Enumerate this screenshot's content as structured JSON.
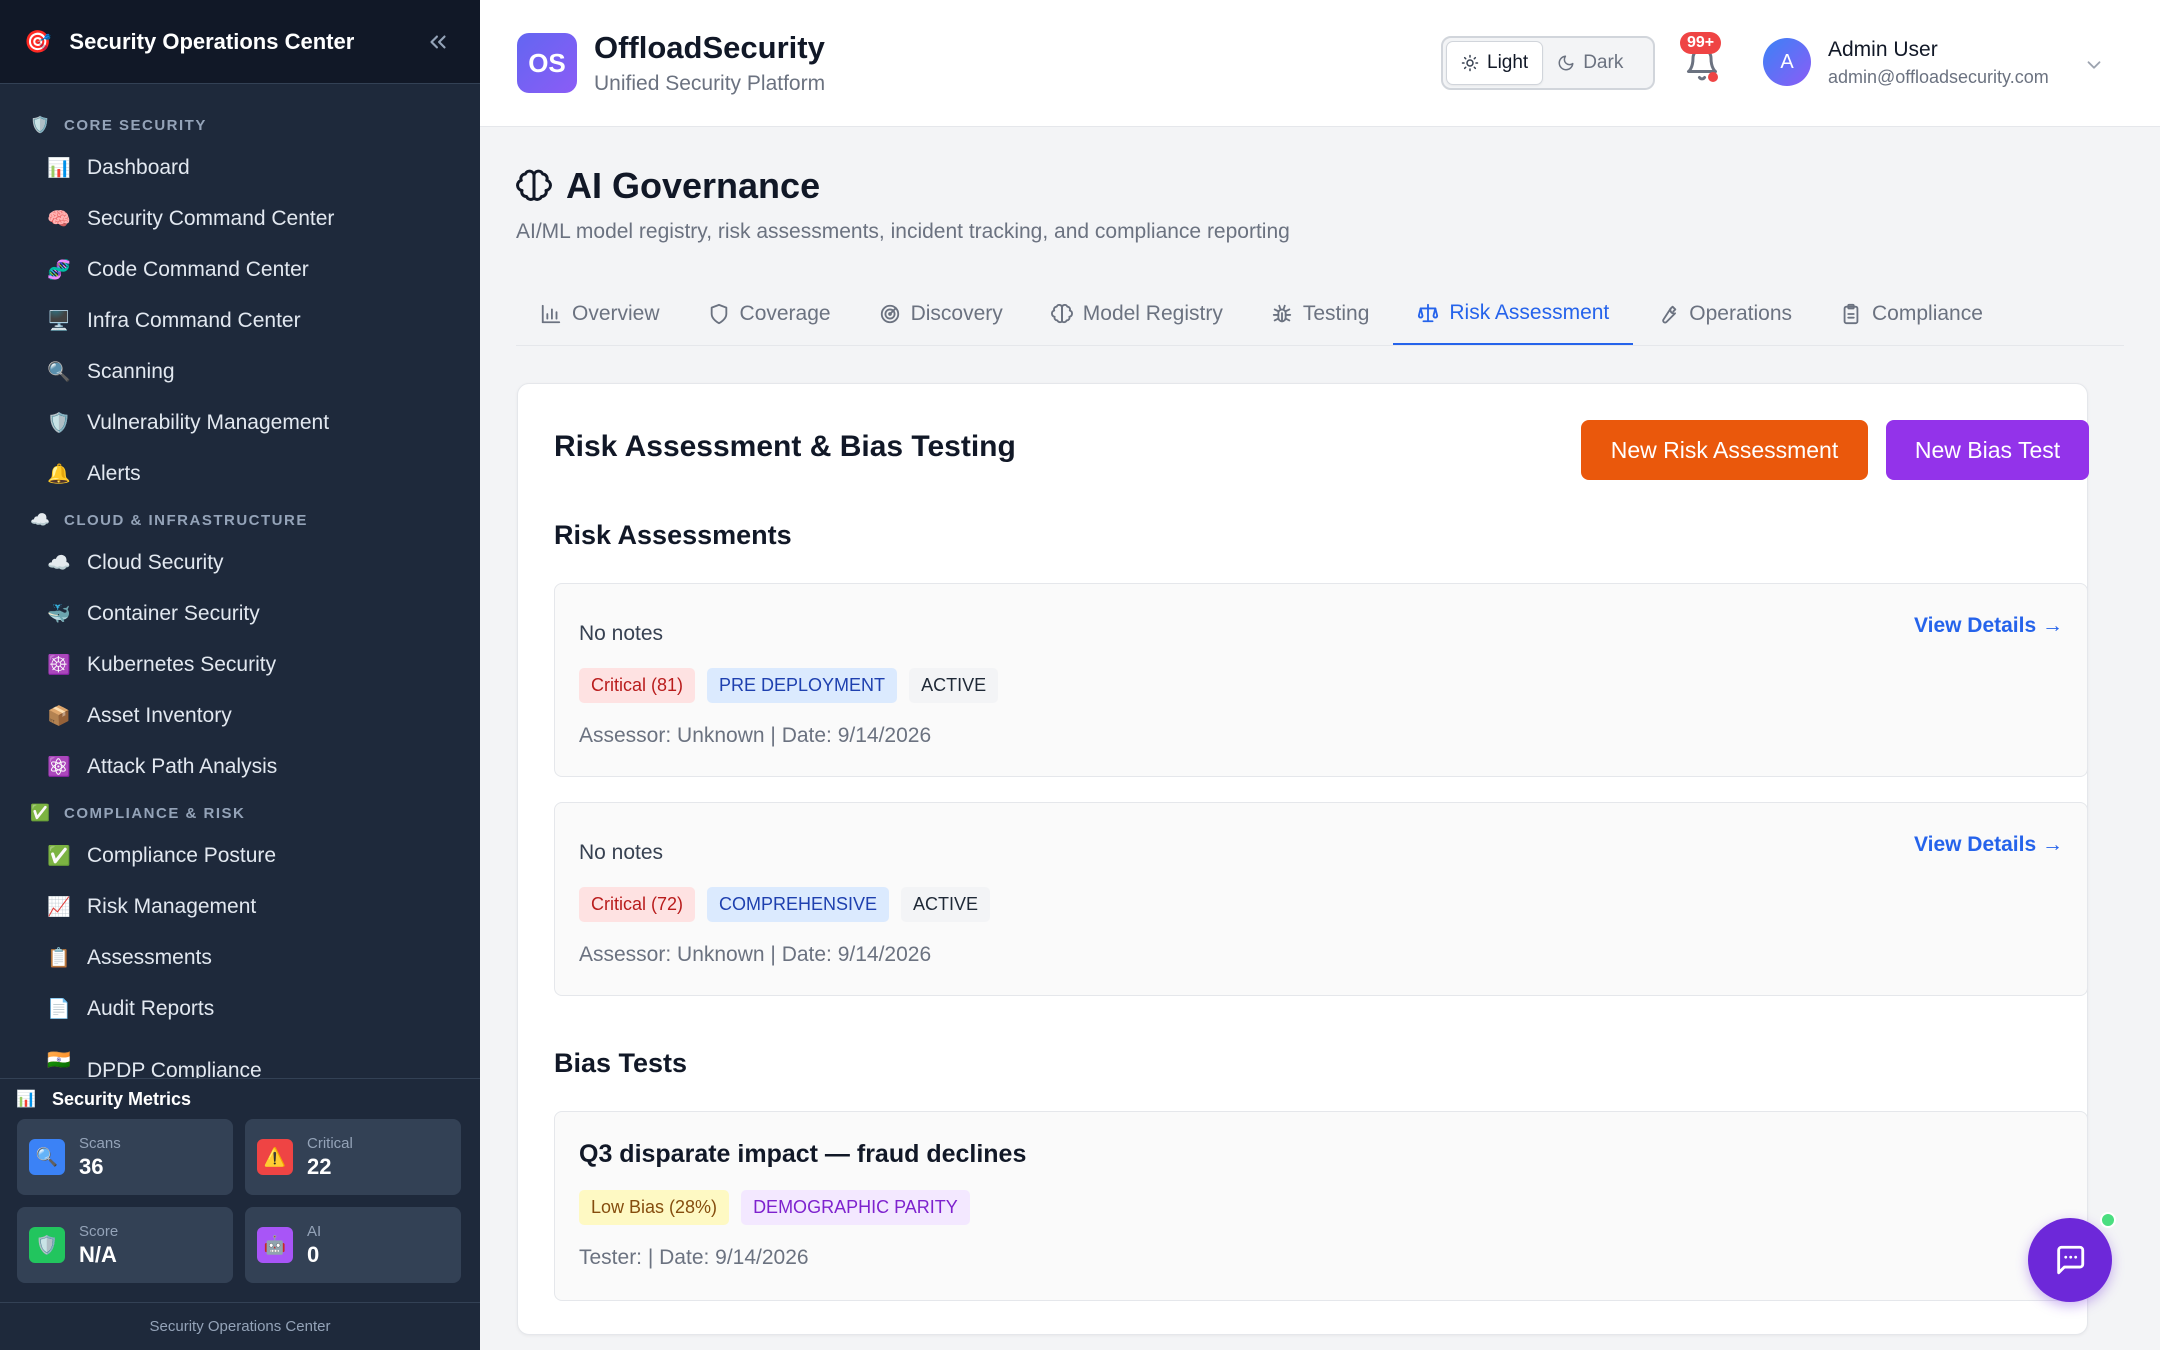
{
  "sidebar": {
    "logo_icon": "🎯",
    "title": "Security Operations Center",
    "sections": [
      {
        "icon": "🛡️",
        "label": "CORE SECURITY",
        "items": [
          {
            "icon": "📊",
            "label": "Dashboard"
          },
          {
            "icon": "🧠",
            "label": "Security Command Center"
          },
          {
            "icon": "🧬",
            "label": "Code Command Center"
          },
          {
            "icon": "🖥️",
            "label": "Infra Command Center"
          },
          {
            "icon": "🔍",
            "label": "Scanning"
          },
          {
            "icon": "🛡️",
            "label": "Vulnerability Management"
          },
          {
            "icon": "🔔",
            "label": "Alerts"
          }
        ]
      },
      {
        "icon": "☁️",
        "label": "CLOUD & INFRASTRUCTURE",
        "items": [
          {
            "icon": "☁️",
            "label": "Cloud Security"
          },
          {
            "icon": "🐳",
            "label": "Container Security"
          },
          {
            "icon": "☸️",
            "label": "Kubernetes Security"
          },
          {
            "icon": "📦",
            "label": "Asset Inventory"
          },
          {
            "icon": "⚛️",
            "label": "Attack Path Analysis"
          }
        ]
      },
      {
        "icon": "✅",
        "label": "COMPLIANCE & RISK",
        "items": [
          {
            "icon": "✅",
            "label": "Compliance Posture"
          },
          {
            "icon": "📈",
            "label": "Risk Management"
          },
          {
            "icon": "📋",
            "label": "Assessments"
          },
          {
            "icon": "📄",
            "label": "Audit Reports"
          },
          {
            "icon": "🇮🇳",
            "label": "DPDP Compliance"
          }
        ]
      }
    ],
    "metrics": {
      "icon": "📊",
      "title": "Security Metrics",
      "cards": [
        {
          "icon": "🔍",
          "label": "Scans",
          "value": "36",
          "color": "#3b82f6"
        },
        {
          "icon": "⚠️",
          "label": "Critical",
          "value": "22",
          "color": "#ef4444"
        },
        {
          "icon": "🛡️",
          "label": "Score",
          "value": "N/A",
          "color": "#22c55e"
        },
        {
          "icon": "🤖",
          "label": "AI",
          "value": "0",
          "color": "#a855f7"
        }
      ]
    },
    "footer": "Security Operations Center"
  },
  "topbar": {
    "logo_text": "OS",
    "brand": "OffloadSecurity",
    "tagline": "Unified Security Platform",
    "theme_light": "Light",
    "theme_dark": "Dark",
    "notification_count": "99+",
    "avatar_initial": "A",
    "user_name": "Admin User",
    "user_email": "admin@offloadsecurity.com"
  },
  "page": {
    "title": "AI Governance",
    "description": "AI/ML model registry, risk assessments, incident tracking, and compliance reporting",
    "tabs": [
      {
        "label": "Overview",
        "icon": "bar-chart-icon"
      },
      {
        "label": "Coverage",
        "icon": "shield-icon"
      },
      {
        "label": "Discovery",
        "icon": "radar-icon"
      },
      {
        "label": "Model Registry",
        "icon": "brain-icon"
      },
      {
        "label": "Testing",
        "icon": "bug-icon"
      },
      {
        "label": "Risk Assessment",
        "icon": "scale-icon",
        "active": true
      },
      {
        "label": "Operations",
        "icon": "wrench-icon"
      },
      {
        "label": "Compliance",
        "icon": "clipboard-icon"
      }
    ]
  },
  "panel": {
    "title": "Risk Assessment & Bias Testing",
    "new_risk_label": "New Risk Assessment",
    "new_bias_label": "New Bias Test",
    "risk_section_title": "Risk Assessments",
    "bias_section_title": "Bias Tests",
    "risk_assessments": [
      {
        "notes": "No notes",
        "risk": "Critical (81)",
        "type": "PRE DEPLOYMENT",
        "status": "ACTIVE",
        "meta": "Assessor: Unknown | Date: 9/14/2026",
        "view": "View Details →"
      },
      {
        "notes": "No notes",
        "risk": "Critical (72)",
        "type": "COMPREHENSIVE",
        "status": "ACTIVE",
        "meta": "Assessor: Unknown | Date: 9/14/2026",
        "view": "View Details →"
      }
    ],
    "bias_tests": [
      {
        "title": "Q3 disparate impact — fraud declines",
        "bias": "Low Bias (28%)",
        "metric": "DEMOGRAPHIC PARITY",
        "meta": "Tester: | Date: 9/14/2026"
      }
    ]
  },
  "colors": {
    "sidebar_bg": "#1e293b",
    "accent_blue": "#2563eb",
    "risk_button": "#ea580c",
    "bias_button": "#9333ea"
  }
}
